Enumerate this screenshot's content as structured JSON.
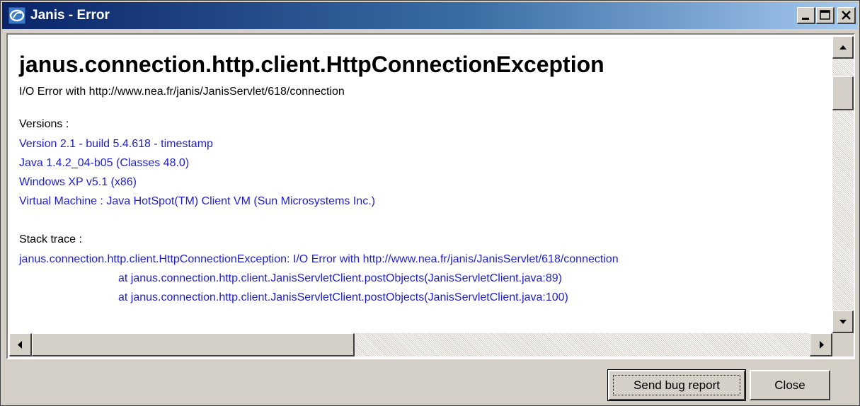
{
  "window": {
    "title": "Janis - Error",
    "app_icon": "janis-app-icon",
    "controls": [
      "minimize-icon",
      "maximize-icon",
      "close-icon"
    ]
  },
  "error": {
    "exception": "janus.connection.http.client.HttpConnectionException",
    "message": "I/O Error with http://www.nea.fr/janis/JanisServlet/618/connection",
    "versions_label": "Versions :",
    "versions": [
      "Version 2.1 - build 5.4.618 - timestamp",
      "Java 1.4.2_04-b05 (Classes 48.0)",
      "Windows XP v5.1 (x86)",
      "Virtual Machine : Java HotSpot(TM) Client VM (Sun Microsystems Inc.)"
    ],
    "stack_label": "Stack trace :",
    "stack": [
      "janus.connection.http.client.HttpConnectionException: I/O Error with http://www.nea.fr/janis/JanisServlet/618/connection",
      "at janus.connection.http.client.JanisServletClient.postObjects(JanisServletClient.java:89)",
      "at janus.connection.http.client.JanisServletClient.postObjects(JanisServletClient.java:100)"
    ]
  },
  "scroll": {
    "vertical_position": 0.08,
    "horizontal_position": 0.0
  },
  "colors": {
    "title_gradient_start": "#0a246a",
    "title_gradient_end": "#a6caf0",
    "link_blue": "#1f1fc8",
    "face": "#d4d0c8"
  },
  "buttons": {
    "send_bug_report": "Send bug report",
    "close": "Close"
  }
}
